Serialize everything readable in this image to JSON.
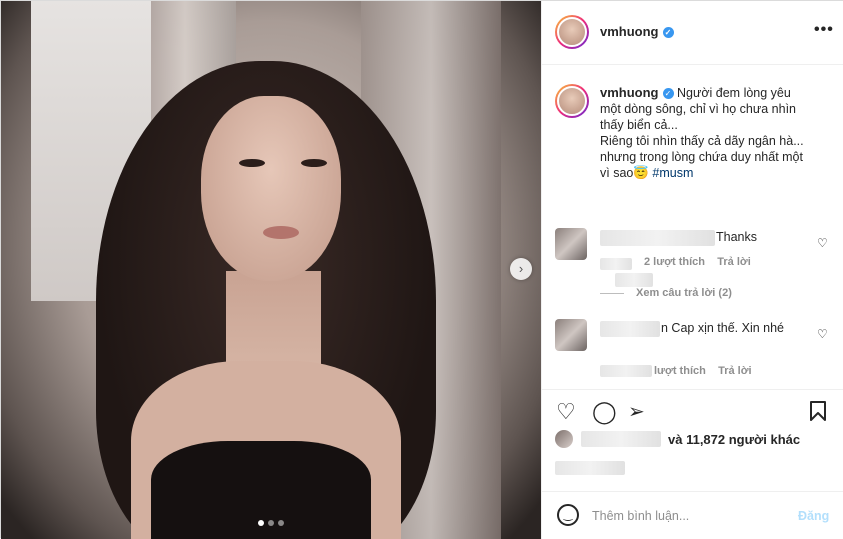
{
  "post": {
    "username": "vmhuong",
    "verified_glyph": "✓",
    "more_glyph": "•••",
    "next_glyph": "›",
    "carousel": {
      "count": 3,
      "active_index": 0
    }
  },
  "caption": {
    "username": "vmhuong",
    "text": "Người đem lòng yêu\nmột dòng sông, chỉ vì họ chưa nhìn\nthấy biển cả...\nRiêng tôi nhìn thấy cả dãy ngân hà...\nnhưng trong lòng chứa duy nhất một\nvì sao😇 ",
    "hashtag": "#musm"
  },
  "comments": [
    {
      "text": "Thanks",
      "likes_label": "2 lượt thích",
      "reply_label": "Trả lời",
      "view_replies": "Xem câu trả lời (2)"
    },
    {
      "text": "n Cap xịn thế. Xin nhé",
      "likes_label": "lượt thích",
      "reply_label": "Trả lời"
    }
  ],
  "likes": {
    "text": "và 11,872 người khác"
  },
  "add_comment": {
    "placeholder": "Thêm bình luận...",
    "post_label": "Đăng"
  },
  "icons": {
    "heart": "heart-icon",
    "comment": "comment-icon",
    "share": "paper-plane-icon",
    "save": "bookmark-icon",
    "emoji": "smile-icon",
    "more": "more-dots-icon"
  },
  "colors": {
    "verified": "#3897f0",
    "hashtag": "#00376b",
    "post_button": "#b2dffc",
    "muted": "#8e8e8e"
  }
}
